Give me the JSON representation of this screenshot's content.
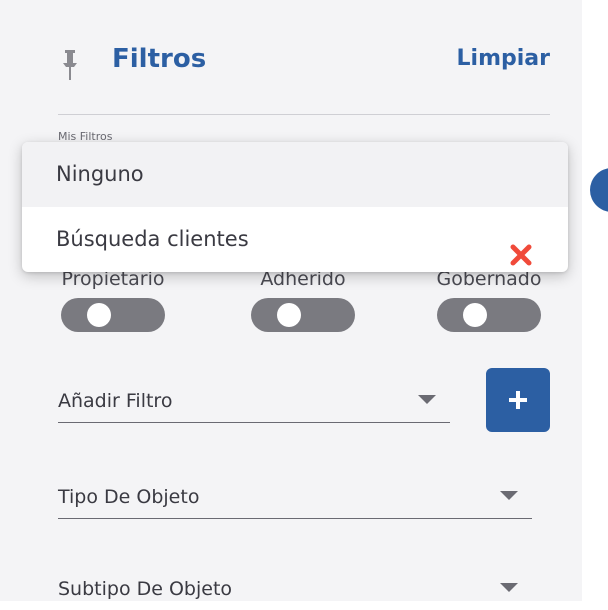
{
  "panel": {
    "title": "Filtros",
    "clear_label": "Limpiar",
    "my_filters_label": "Mis Filtros"
  },
  "dropdown": {
    "options": [
      {
        "label": "Ninguno",
        "selected": true
      },
      {
        "label": "Búsqueda clientes",
        "selected": false,
        "delete_icon": "close-icon"
      }
    ]
  },
  "toggles": [
    {
      "label": "Propietario",
      "on": false
    },
    {
      "label": "Adherido",
      "on": false
    },
    {
      "label": "Gobernado",
      "on": false
    }
  ],
  "fields": {
    "add_filter": "Añadir Filtro",
    "object_type": "Tipo De Objeto",
    "object_subtype": "Subtipo De Objeto"
  },
  "colors": {
    "accent": "#2c5fa3",
    "delete": "#f04a3a",
    "toggle_off": "#7a7a80"
  }
}
